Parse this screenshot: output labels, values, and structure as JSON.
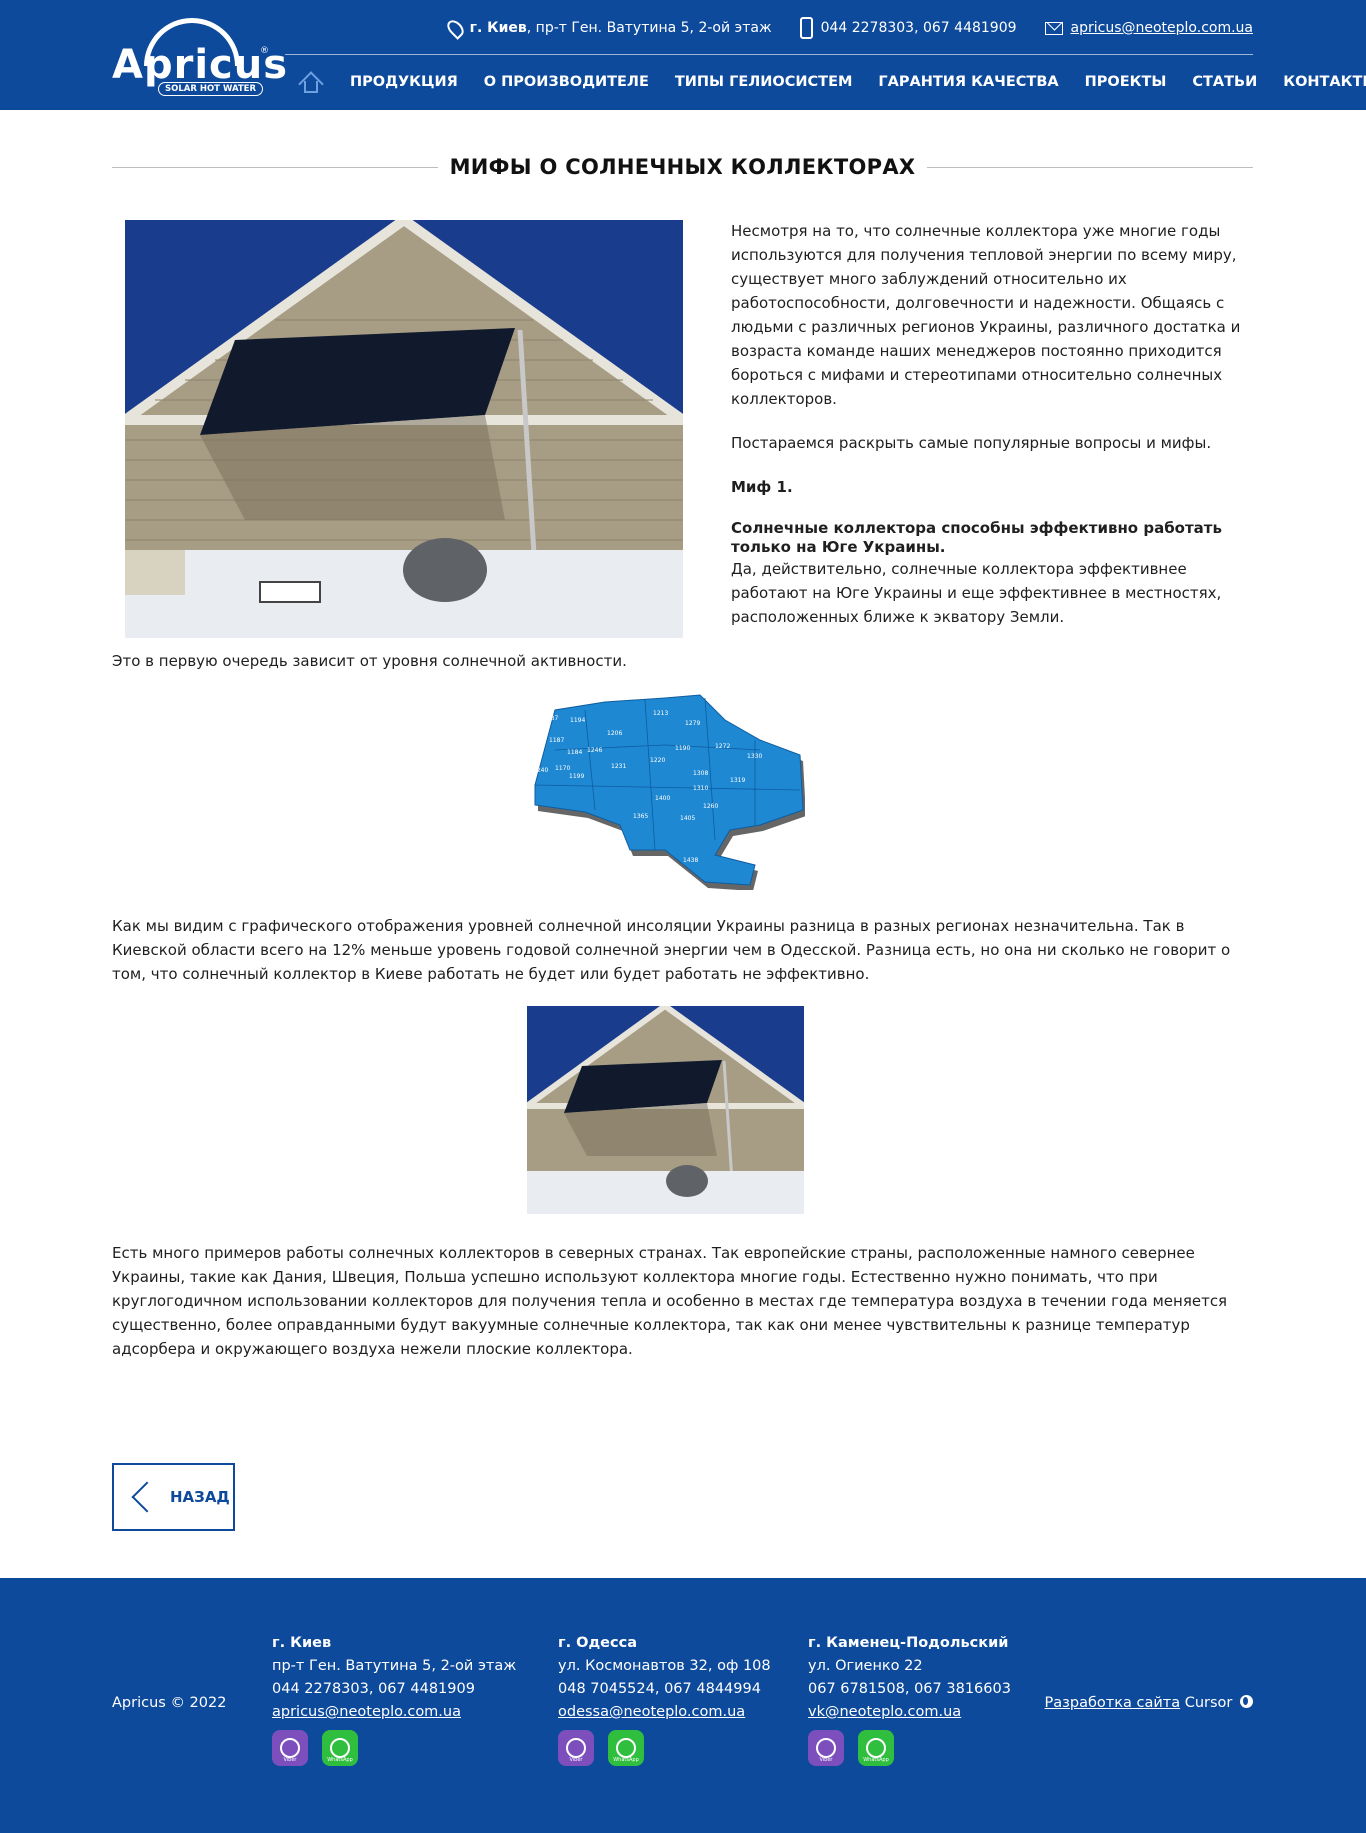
{
  "brand": {
    "name": "Apricus",
    "reg": "®",
    "tagline": "SOLAR HOT WATER"
  },
  "header": {
    "address_city": "г. Киев",
    "address_rest": ", пр-т Ген. Ватутина 5, 2-ой этаж",
    "phones": "044 2278303, 067 4481909",
    "email": "apricus@neoteplo.com.ua"
  },
  "nav": {
    "items": [
      "ПРОДУКЦИЯ",
      "О ПРОИЗВОДИТЕЛЕ",
      "ТИПЫ ГЕЛИОСИСТЕМ",
      "ГАРАНТИЯ КАЧЕСТВА",
      "ПРОЕКТЫ",
      "СТАТЬИ",
      "КОНТАКТЫ"
    ]
  },
  "article": {
    "title": "МИФЫ О СОЛНЕЧНЫХ КОЛЛЕКТОРАХ",
    "intro": "Несмотря на то, что солнечные коллектора уже многие годы используются для получения тепловой энергии по всему миру, существует много заблуждений относительно их работоспособности, долговечности и надежности. Общаясь с людьми с различных регионов Украины, различного достатка и возраста команде наших менеджеров постоянно приходится бороться с мифами и стереотипами относительно солнечных коллекторов.",
    "p2": "Постараемся раскрыть самые популярные вопросы и мифы.",
    "myth_label": "Миф 1.",
    "myth_heading": "Солнечные коллектора способны эффективно работать только на Юге Украины.",
    "myth_text": "Да, действительно, солнечные коллектора эффективнее работают на Юге Украины и еще эффективнее в местностях, расположенных ближе к экватору Земли.",
    "after_photo": "Это в первую очередь зависит от уровня солнечной активности.",
    "insolation": "Как мы видим с графического отображения уровней солнечной инсоляции Украины разница в разных регионах незначительна. Так в Киевской области всего на 12% меньше уровень годовой солнечной энергии чем в Одесской. Разница есть, но она ни сколько не говорит о том, что солнечный коллектор в Киеве работать не будет или будет работать не эффективно.",
    "north": "Есть много примеров работы солнечных коллекторов в северных странах. Так европейские страны, расположенные намного севернее Украины, такие как Дания, Швеция, Польша успешно используют коллектора многие годы. Естественно нужно понимать, что при круглогодичном использовании коллекторов для получения тепла и особенно в местах где температура воздуха в течении года меняется существенно, более оправданными будут вакуумные солнечные коллектора, так как они менее чувствительны к разнице температур адсорбера и окружающего воздуха нежели плоские коллектора.",
    "back_label": "НАЗАД"
  },
  "map_values": [
    "1187",
    "1194",
    "1206",
    "1213",
    "1279",
    "1187",
    "1184",
    "1246",
    "1231",
    "1220",
    "1190",
    "1272",
    "1330",
    "1240",
    "1170",
    "1199",
    "1308",
    "1310",
    "1319",
    "1400",
    "1260",
    "1365",
    "1405",
    "1438"
  ],
  "footer": {
    "copyright": "Apricus © 2022",
    "offices": [
      {
        "city": "г. Киев",
        "address": "пр-т Ген. Ватутина 5, 2-ой этаж",
        "phones": "044 2278303, 067 4481909",
        "email": "apricus@neoteplo.com.ua"
      },
      {
        "city": "г. Одесса",
        "address": "ул. Космонавтов 32, оф 108",
        "phones": "048 7045524, 067 4844994",
        "email": "odessa@neoteplo.com.ua"
      },
      {
        "city": "г. Каменец-Подольский",
        "address": "ул. Огиенко 22",
        "phones": "067 6781508, 067 3816603",
        "email": "vk@neoteplo.com.ua"
      }
    ],
    "viber_label": "Viber",
    "whatsapp_label": "WhatsApp",
    "dev_link": "Разработка сайта",
    "dev_name": "Cursor"
  },
  "colors": {
    "brand_blue": "#0d4a9c",
    "map_blue": "#1e88d2"
  }
}
